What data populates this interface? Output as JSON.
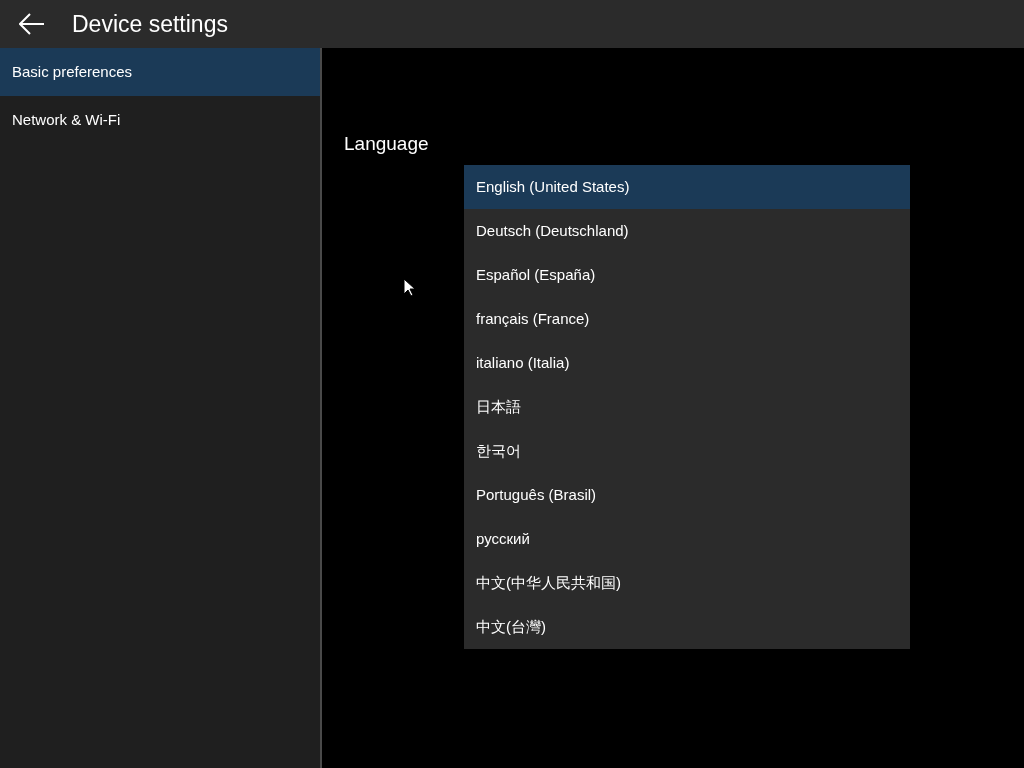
{
  "header": {
    "title": "Device settings"
  },
  "sidebar": {
    "items": [
      {
        "label": "Basic preferences",
        "selected": true
      },
      {
        "label": "Network & Wi-Fi",
        "selected": false
      }
    ]
  },
  "language": {
    "label": "Language",
    "options": [
      {
        "label": "English (United States)",
        "selected": true
      },
      {
        "label": "Deutsch (Deutschland)",
        "selected": false
      },
      {
        "label": "Español (España)",
        "selected": false
      },
      {
        "label": "français (France)",
        "selected": false
      },
      {
        "label": "italiano (Italia)",
        "selected": false
      },
      {
        "label": "日本語",
        "selected": false
      },
      {
        "label": "한국어",
        "selected": false
      },
      {
        "label": "Português (Brasil)",
        "selected": false
      },
      {
        "label": "русский",
        "selected": false
      },
      {
        "label": "中文(中华人民共和国)",
        "selected": false
      },
      {
        "label": "中文(台灣)",
        "selected": false
      }
    ]
  }
}
